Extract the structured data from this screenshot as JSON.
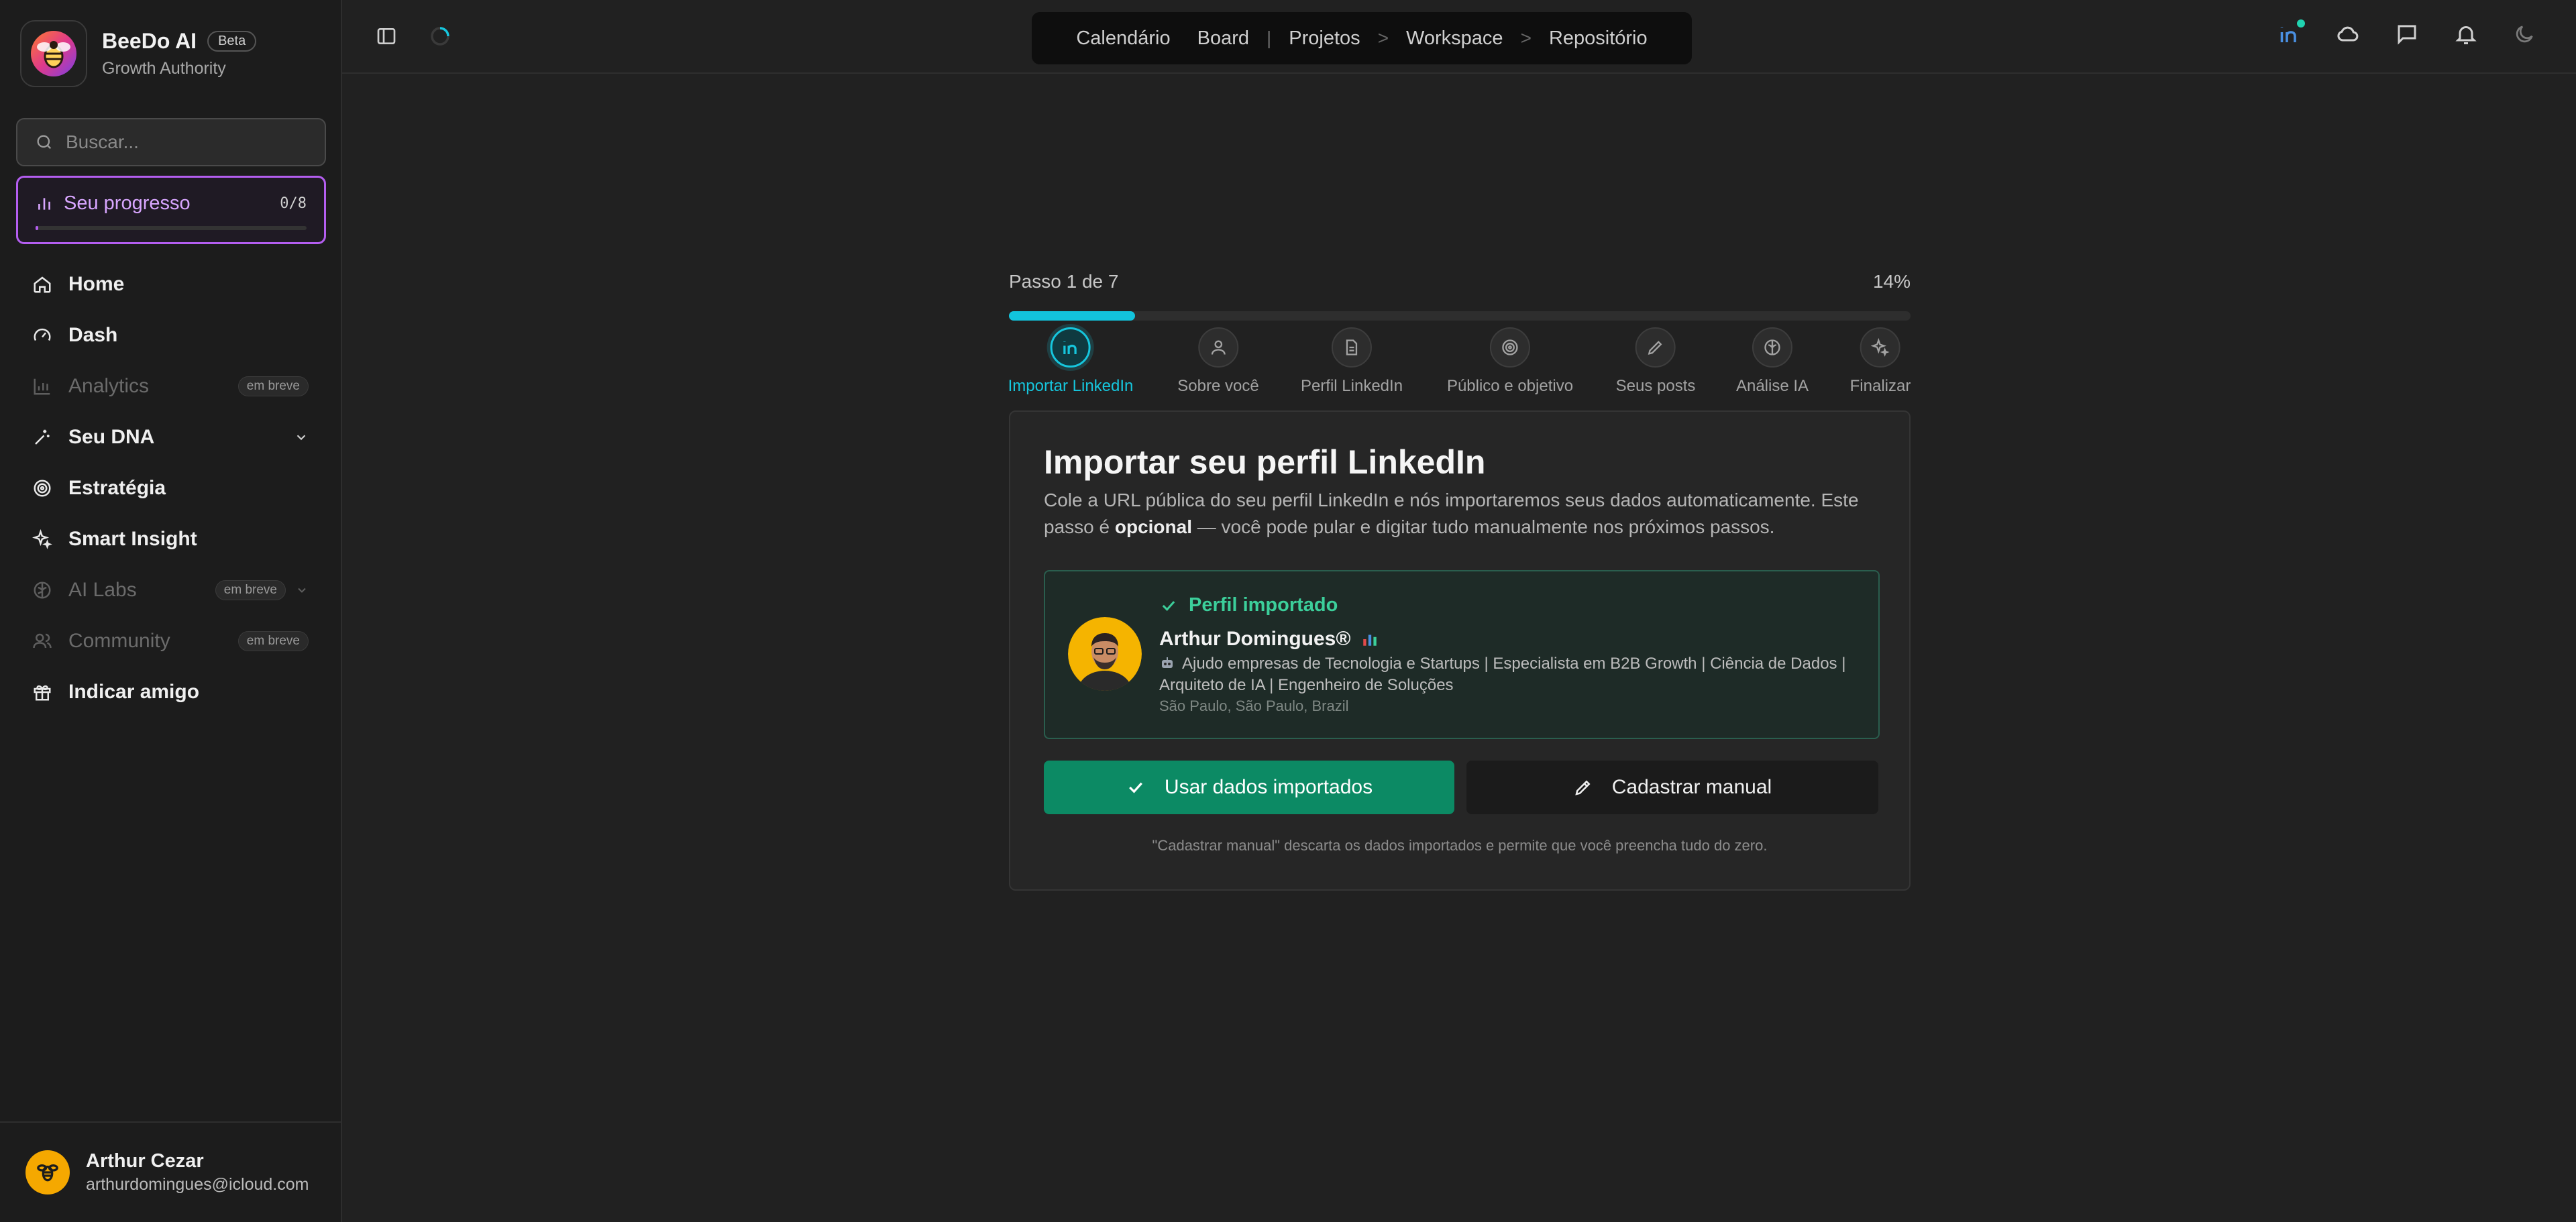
{
  "brand": {
    "name": "BeeDo AI",
    "badge": "Beta",
    "subtitle": "Growth Authority"
  },
  "search": {
    "placeholder": "Buscar..."
  },
  "progress": {
    "label": "Seu progresso",
    "count": "0/8",
    "completed": 0,
    "total": 8
  },
  "nav": {
    "home": "Home",
    "dash": "Dash",
    "analytics": "Analytics",
    "analytics_badge": "em breve",
    "dna": "Seu DNA",
    "estrategia": "Estratégia",
    "smart_insight": "Smart Insight",
    "ai_labs": "AI Labs",
    "ai_labs_badge": "em breve",
    "community": "Community",
    "community_badge": "em breve",
    "indicar": "Indicar amigo"
  },
  "user": {
    "name": "Arthur Cezar",
    "email": "arthurdomingues@icloud.com"
  },
  "topnav": {
    "calendario": "Calendário",
    "board": "Board",
    "sep_pipe": "|",
    "projetos": "Projetos",
    "sep1": ">",
    "workspace": "Workspace",
    "sep2": ">",
    "repositorio": "Repositório"
  },
  "wizard": {
    "step_text": "Passo 1 de 7",
    "percent_text": "14%",
    "percent": 14,
    "steps": [
      {
        "label": "Importar LinkedIn",
        "icon": "linkedin-icon"
      },
      {
        "label": "Sobre você",
        "icon": "user-icon"
      },
      {
        "label": "Perfil LinkedIn",
        "icon": "document-icon"
      },
      {
        "label": "Público e objetivo",
        "icon": "target-icon"
      },
      {
        "label": "Seus posts",
        "icon": "pencil-icon"
      },
      {
        "label": "Análise IA",
        "icon": "brain-icon"
      },
      {
        "label": "Finalizar",
        "icon": "sparkles-icon"
      }
    ]
  },
  "card": {
    "title": "Importar seu perfil LinkedIn",
    "desc_1": "Cole a URL pública do seu perfil LinkedIn e nós importaremos seus dados automaticamente. Este passo é ",
    "desc_bold": "opcional",
    "desc_2": " — você pode pular e digitar tudo manualmente nos próximos passos.",
    "status": "Perfil importado",
    "profile_name": "Arthur Domingues®",
    "headline": "Ajudo empresas de Tecnologia e Startups | Especialista em B2B Growth | Ciência de Dados | Arquiteto de IA | Engenheiro de Soluções",
    "location": "São Paulo, São Paulo, Brazil",
    "use_button": "Usar dados importados",
    "manual_button": "Cadastrar manual",
    "note": "\"Cadastrar manual\" descarta os dados importados e permite que você preencha tudo do zero."
  },
  "colors": {
    "accent_cyan": "#16c6dd",
    "progress_purple": "#b45ef0",
    "success_green": "#0c8a64",
    "status_green": "#3ccf9b",
    "avatar_yellow": "#f5a800"
  }
}
